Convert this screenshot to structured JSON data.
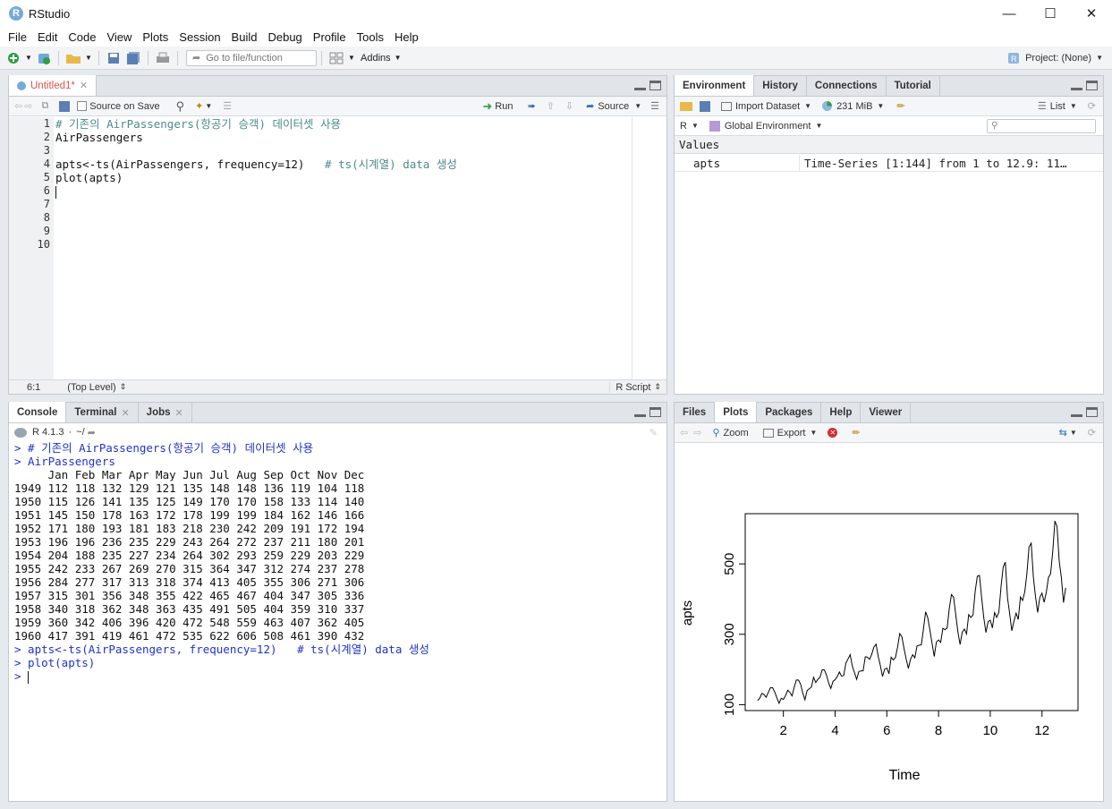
{
  "window": {
    "title": "RStudio",
    "logo_letter": "R"
  },
  "menu": [
    "File",
    "Edit",
    "Code",
    "View",
    "Plots",
    "Session",
    "Build",
    "Debug",
    "Profile",
    "Tools",
    "Help"
  ],
  "toolbar": {
    "goto_placeholder": "Go to file/function",
    "addins_label": "Addins",
    "project_label": "Project: (None)"
  },
  "editor": {
    "tab_label": "Untitled1*",
    "source_on_save": "Source on Save",
    "run_label": "Run",
    "source_label": "Source",
    "line_numbers": [
      "1",
      "2",
      "3",
      "4",
      "5",
      "6",
      "7",
      "8",
      "9",
      "10"
    ],
    "lines": [
      {
        "code": "",
        "comment": "# 기존의 AirPassengers(항공기 승객) 데이터셋 사용"
      },
      {
        "code": "AirPassengers",
        "comment": ""
      },
      {
        "code": "",
        "comment": ""
      },
      {
        "code": "apts<-ts(AirPassengers, frequency=12)   ",
        "comment": "# ts(시계열) data 생성"
      },
      {
        "code": "plot(apts)",
        "comment": ""
      }
    ],
    "cursor_pos": "6:1",
    "scope": "(Top Level)",
    "file_type": "R Script"
  },
  "console": {
    "tabs": [
      "Console",
      "Terminal",
      "Jobs"
    ],
    "r_version": "R 4.1.3",
    "wd": "~/",
    "lines": [
      {
        "text": "> # 기존의 AirPassengers(항공기 승객) 데이터셋 사용",
        "cls": "blue"
      },
      {
        "text": "> AirPassengers",
        "cls": "blue"
      },
      {
        "text": "     Jan Feb Mar Apr May Jun Jul Aug Sep Oct Nov Dec",
        "cls": "black"
      },
      {
        "text": "1949 112 118 132 129 121 135 148 148 136 119 104 118",
        "cls": "black"
      },
      {
        "text": "1950 115 126 141 135 125 149 170 170 158 133 114 140",
        "cls": "black"
      },
      {
        "text": "1951 145 150 178 163 172 178 199 199 184 162 146 166",
        "cls": "black"
      },
      {
        "text": "1952 171 180 193 181 183 218 230 242 209 191 172 194",
        "cls": "black"
      },
      {
        "text": "1953 196 196 236 235 229 243 264 272 237 211 180 201",
        "cls": "black"
      },
      {
        "text": "1954 204 188 235 227 234 264 302 293 259 229 203 229",
        "cls": "black"
      },
      {
        "text": "1955 242 233 267 269 270 315 364 347 312 274 237 278",
        "cls": "black"
      },
      {
        "text": "1956 284 277 317 313 318 374 413 405 355 306 271 306",
        "cls": "black"
      },
      {
        "text": "1957 315 301 356 348 355 422 465 467 404 347 305 336",
        "cls": "black"
      },
      {
        "text": "1958 340 318 362 348 363 435 491 505 404 359 310 337",
        "cls": "black"
      },
      {
        "text": "1959 360 342 406 396 420 472 548 559 463 407 362 405",
        "cls": "black"
      },
      {
        "text": "1960 417 391 419 461 472 535 622 606 508 461 390 432",
        "cls": "black"
      },
      {
        "text": "> apts<-ts(AirPassengers, frequency=12)   # ts(시계열) data 생성",
        "cls": "blue"
      },
      {
        "text": "> plot(apts)",
        "cls": "blue"
      }
    ],
    "prompt": "> "
  },
  "environment": {
    "tabs": [
      "Environment",
      "History",
      "Connections",
      "Tutorial"
    ],
    "import_label": "Import Dataset",
    "memory_label": "231 MiB",
    "view_label": "List",
    "lang_label": "R",
    "scope_label": "Global Environment",
    "section_label": "Values",
    "rows": [
      {
        "name": "apts",
        "value": "Time-Series [1:144] from 1 to 12.9: 11…"
      }
    ]
  },
  "files": {
    "tabs": [
      "Files",
      "Plots",
      "Packages",
      "Help",
      "Viewer"
    ],
    "zoom_label": "Zoom",
    "export_label": "Export"
  },
  "chart_data": {
    "type": "line",
    "xlabel": "Time",
    "ylabel": "apts",
    "x_ticks": [
      "2",
      "4",
      "6",
      "8",
      "10",
      "12"
    ],
    "y_ticks": [
      "100",
      "300",
      "500"
    ],
    "x_range": [
      1,
      12.9167
    ],
    "y_range": [
      104,
      622
    ],
    "frequency": 12,
    "series": [
      {
        "values": [
          112,
          118,
          132,
          129,
          121,
          135,
          148,
          148,
          136,
          119,
          104,
          118,
          115,
          126,
          141,
          135,
          125,
          149,
          170,
          170,
          158,
          133,
          114,
          140,
          145,
          150,
          178,
          163,
          172,
          178,
          199,
          199,
          184,
          162,
          146,
          166,
          171,
          180,
          193,
          181,
          183,
          218,
          230,
          242,
          209,
          191,
          172,
          194,
          196,
          196,
          236,
          235,
          229,
          243,
          264,
          272,
          237,
          211,
          180,
          201,
          204,
          188,
          235,
          227,
          234,
          264,
          302,
          293,
          259,
          229,
          203,
          229,
          242,
          233,
          267,
          269,
          270,
          315,
          364,
          347,
          312,
          274,
          237,
          278,
          284,
          277,
          317,
          313,
          318,
          374,
          413,
          405,
          355,
          306,
          271,
          306,
          315,
          301,
          356,
          348,
          355,
          422,
          465,
          467,
          404,
          347,
          305,
          336,
          340,
          318,
          362,
          348,
          363,
          435,
          491,
          505,
          404,
          359,
          310,
          337,
          360,
          342,
          406,
          396,
          420,
          472,
          548,
          559,
          463,
          407,
          362,
          405,
          417,
          391,
          419,
          461,
          472,
          535,
          622,
          606,
          508,
          461,
          390,
          432
        ]
      }
    ]
  }
}
